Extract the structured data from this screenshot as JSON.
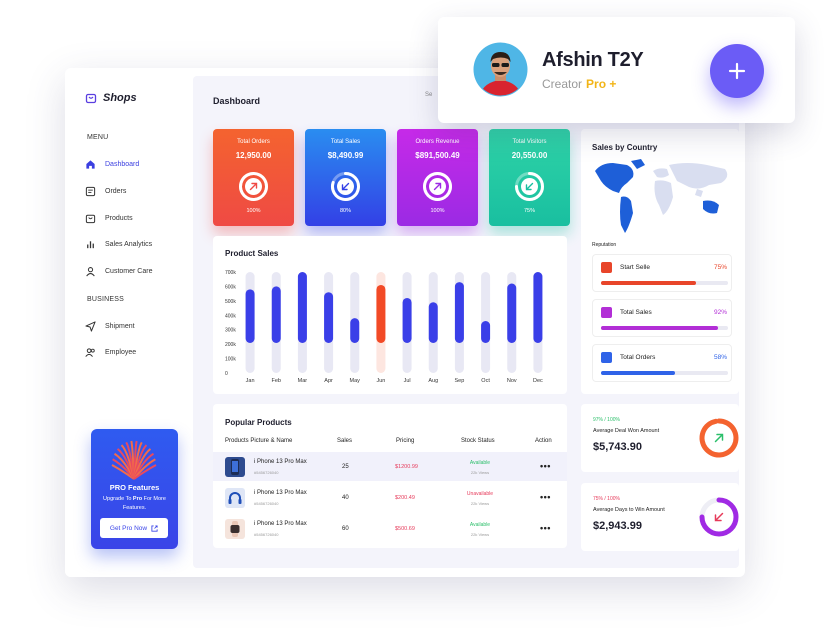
{
  "brand": {
    "name": "Shops"
  },
  "sidebar": {
    "menu_label": "MENU",
    "menu_items": [
      {
        "label": "Dashboard",
        "icon": "home-icon",
        "active": true
      },
      {
        "label": "Orders",
        "icon": "orders-icon"
      },
      {
        "label": "Products",
        "icon": "bag-icon"
      },
      {
        "label": "Sales Analytics",
        "icon": "bar-chart-icon"
      },
      {
        "label": "Customer Care",
        "icon": "user-icon"
      }
    ],
    "business_label": "BUSINESS",
    "business_items": [
      {
        "label": "Shipment",
        "icon": "send-icon"
      },
      {
        "label": "Employee",
        "icon": "users-icon"
      }
    ]
  },
  "pro_card": {
    "title": "PRO Features",
    "desc_before": "Upgrade To ",
    "desc_bold": "Pro",
    "desc_after": " For More Features.",
    "button": "Get Pro Now"
  },
  "header": {
    "title": "Dashboard",
    "search_placeholder": "Se"
  },
  "stats": [
    {
      "title": "Total Orders",
      "value": "12,950.00",
      "percent": "100%",
      "fraction": 1.0,
      "arrow": "up",
      "color_from": "#f4632f",
      "color_to": "#ef4a44"
    },
    {
      "title": "Total Sales",
      "value": "$8,490.99",
      "percent": "80%",
      "fraction": 0.8,
      "arrow": "down",
      "color_from": "#2a8df0",
      "color_to": "#3340e6"
    },
    {
      "title": "Orders Revenue",
      "value": "$891,500.49",
      "percent": "100%",
      "fraction": 1.0,
      "arrow": "up",
      "color_from": "#c62ae8",
      "color_to": "#9b2ae4"
    },
    {
      "title": "Total Visitors",
      "value": "20,550.00",
      "percent": "75%",
      "fraction": 0.75,
      "arrow": "down",
      "color_from": "#2fd3a7",
      "color_to": "#19bfa0"
    }
  ],
  "product_sales": {
    "title": "Product Sales"
  },
  "chart_data": {
    "type": "bar",
    "title": "Product Sales",
    "categories": [
      "Jan",
      "Feb",
      "Mar",
      "Apr",
      "May",
      "Jun",
      "Jul",
      "Aug",
      "Sep",
      "Oct",
      "Nov",
      "Dec"
    ],
    "y_ticks": [
      "700k",
      "600k",
      "500k",
      "400k",
      "300k",
      "200k",
      "100k",
      "0"
    ],
    "ylim": [
      0,
      700000
    ],
    "series": [
      {
        "values": [
          580000,
          600000,
          700000,
          560000,
          380000,
          610000,
          520000,
          490000,
          630000,
          360000,
          620000,
          700000
        ]
      }
    ],
    "highlight_index": 5,
    "colors": {
      "bar": "#3a3fe8",
      "bar_highlight": "#f24a26",
      "bg_bar": "#e8e8f4",
      "bg_bar_highlight": "#fde6e0"
    }
  },
  "popular_products": {
    "title": "Popular Products",
    "columns": [
      "Products Picture & Name",
      "Sales",
      "Pricing",
      "Stock Status",
      "Action"
    ],
    "rows": [
      {
        "name": "i Phone 13 Pro Max",
        "id": "#5456726040",
        "sales": "25",
        "price": "$1200.99",
        "status": "Available",
        "status_color": "#2bbf6a",
        "views": "22k Views",
        "thumb": "phone-icon"
      },
      {
        "name": "i Phone 13 Pro Max",
        "id": "#5456726040",
        "sales": "40",
        "price": "$200.49",
        "status": "Unavailable",
        "status_color": "#e63a5a",
        "views": "22k Views",
        "thumb": "headphones-icon"
      },
      {
        "name": "i Phone 13 Pro Max",
        "id": "#5456726040",
        "sales": "60",
        "price": "$500.69",
        "status": "Available",
        "status_color": "#2bbf6a",
        "views": "22k Views",
        "thumb": "watch-icon"
      }
    ]
  },
  "sales_by_country": {
    "title": "Sales by Country",
    "reputation_label": "Reputation",
    "items": [
      {
        "label": "Start Selle",
        "percent": "75%",
        "fraction": 0.75,
        "color": "#e8452a"
      },
      {
        "label": "Total Sales",
        "percent": "92%",
        "fraction": 0.92,
        "color": "#b22ed6"
      },
      {
        "label": "Total Orders",
        "percent": "58%",
        "fraction": 0.58,
        "color": "#2f63e8"
      }
    ]
  },
  "deals": [
    {
      "ratio": "97% / 100%",
      "label": "Average Deal Won Amount",
      "value": "$5,743.90",
      "ratio_color": "#2bbf6a",
      "ring_color": "#f4632f",
      "fraction": 0.97,
      "arrow": "up",
      "arrow_color": "#2bbf6a"
    },
    {
      "ratio": "75% / 100%",
      "label": "Average Days to Win Amount",
      "value": "$2,943.99",
      "ratio_color": "#e63a5a",
      "ring_color": "#a02ae4",
      "fraction": 0.75,
      "arrow": "down",
      "arrow_color": "#e63a5a"
    }
  ],
  "profile": {
    "name": "Afshin T2Y",
    "role": "Creator",
    "badge": "Pro +",
    "add_label": "+"
  }
}
